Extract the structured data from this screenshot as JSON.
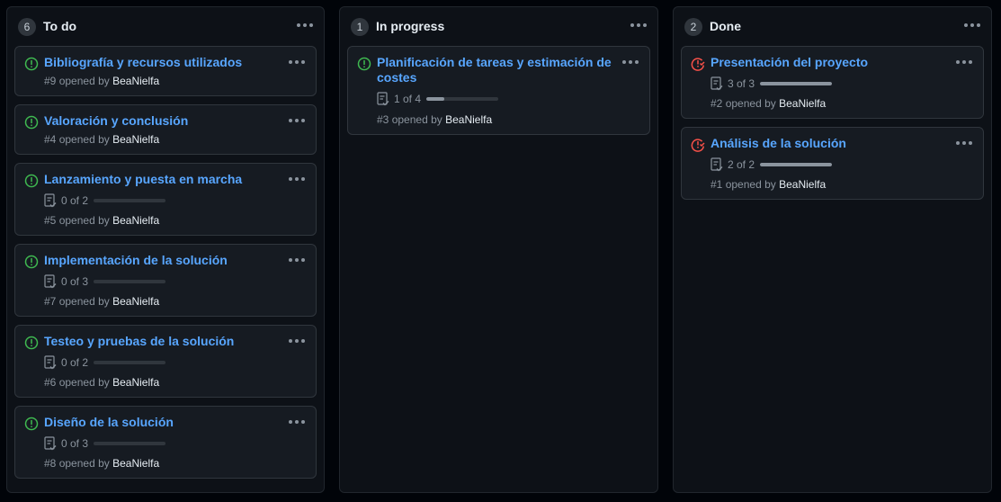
{
  "columns": [
    {
      "id": "todo",
      "title": "To do",
      "count": "6",
      "cards": [
        {
          "title": "Bibliografía y recursos utilizados",
          "number": "#9",
          "opened": "opened by",
          "author": "BeaNielfa",
          "status": "open"
        },
        {
          "title": "Valoración y conclusión",
          "number": "#4",
          "opened": "opened by",
          "author": "BeaNielfa",
          "status": "open"
        },
        {
          "title": "Lanzamiento y puesta en marcha",
          "number": "#5",
          "opened": "opened by",
          "author": "BeaNielfa",
          "status": "open",
          "tasks": {
            "label": "0 of 2",
            "fraction": 0
          }
        },
        {
          "title": "Implementación de la solución",
          "number": "#7",
          "opened": "opened by",
          "author": "BeaNielfa",
          "status": "open",
          "tasks": {
            "label": "0 of 3",
            "fraction": 0
          }
        },
        {
          "title": "Testeo y pruebas de la solución",
          "number": "#6",
          "opened": "opened by",
          "author": "BeaNielfa",
          "status": "open",
          "tasks": {
            "label": "0 of 2",
            "fraction": 0
          }
        },
        {
          "title": "Diseño de la solución",
          "number": "#8",
          "opened": "opened by",
          "author": "BeaNielfa",
          "status": "open",
          "tasks": {
            "label": "0 of 3",
            "fraction": 0
          }
        }
      ]
    },
    {
      "id": "progress",
      "title": "In progress",
      "count": "1",
      "cards": [
        {
          "title": "Planificación de tareas y estimación de costes",
          "number": "#3",
          "opened": "opened by",
          "author": "BeaNielfa",
          "status": "open",
          "tasks": {
            "label": "1 of 4",
            "fraction": 0.25
          }
        }
      ]
    },
    {
      "id": "done",
      "title": "Done",
      "count": "2",
      "cards": [
        {
          "title": "Presentación del proyecto",
          "number": "#2",
          "opened": "opened by",
          "author": "BeaNielfa",
          "status": "closed",
          "tasks": {
            "label": "3 of 3",
            "fraction": 1
          }
        },
        {
          "title": "Análisis de la solución",
          "number": "#1",
          "opened": "opened by",
          "author": "BeaNielfa",
          "status": "closed",
          "tasks": {
            "label": "2 of 2",
            "fraction": 1
          }
        }
      ]
    }
  ],
  "colors": {
    "open_icon": "#3fb950",
    "closed_icon": "#f85149",
    "link": "#58a6ff",
    "background": "#010409",
    "column_bg": "#0d1117",
    "card_bg": "#161b22"
  },
  "icons": {
    "open": "issue-opened-icon",
    "closed": "issue-closed-icon",
    "tasklist": "tasklist-icon",
    "menu": "kebab-horizontal-icon"
  }
}
